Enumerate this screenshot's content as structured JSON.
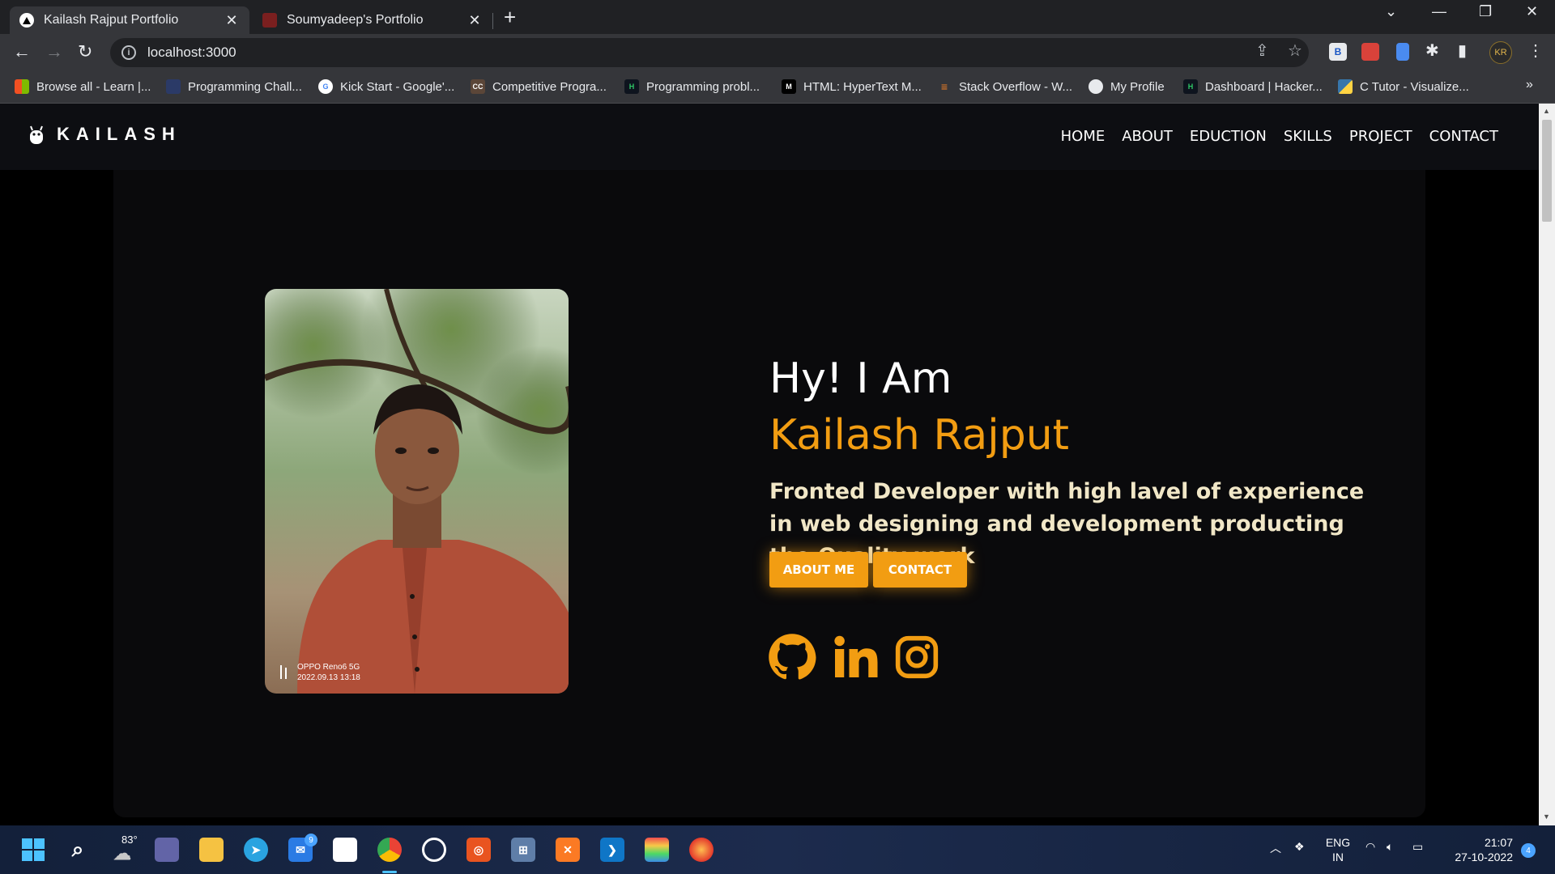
{
  "browser": {
    "tabs": [
      {
        "title": "Kailash Rajput Portfolio",
        "active": true
      },
      {
        "title": "Soumyadeep's Portfolio",
        "active": false
      }
    ],
    "url": "localhost:3000",
    "profile_initials": "KR",
    "bookmarks": [
      "Browse all - Learn |...",
      "Programming Chall...",
      "Kick Start - Google'...",
      "Competitive Progra...",
      "Programming probl...",
      "HTML: HyperText M...",
      "Stack Overflow - W...",
      "My Profile",
      "Dashboard | Hacker...",
      "C Tutor - Visualize..."
    ],
    "bookmark_overflow": "»"
  },
  "site": {
    "brand": "KAILASH",
    "nav": [
      "HOME",
      "ABOUT",
      "EDUCTION",
      "SKILLS",
      "PROJECT",
      "CONTACT"
    ],
    "hero": {
      "greeting": "Hy! I Am",
      "name": "Kailash Rajput",
      "tagline": "Fronted Developer with high lavel of experience in web designing and development producting the Quality work",
      "buttons": {
        "about": "ABOUT ME",
        "contact": "CONTACT"
      },
      "photo_watermark": {
        "device": "OPPO Reno6 5G",
        "timestamp": "2022.09.13 13:18"
      },
      "socials": [
        "github-icon",
        "linkedin-icon",
        "instagram-icon"
      ]
    },
    "accent_color": "#f29d12"
  },
  "taskbar": {
    "weather": "83°",
    "mail_badge": "9",
    "language": "ENG",
    "region": "IN",
    "time": "21:07",
    "date": "27-10-2022",
    "notifications": "4"
  }
}
